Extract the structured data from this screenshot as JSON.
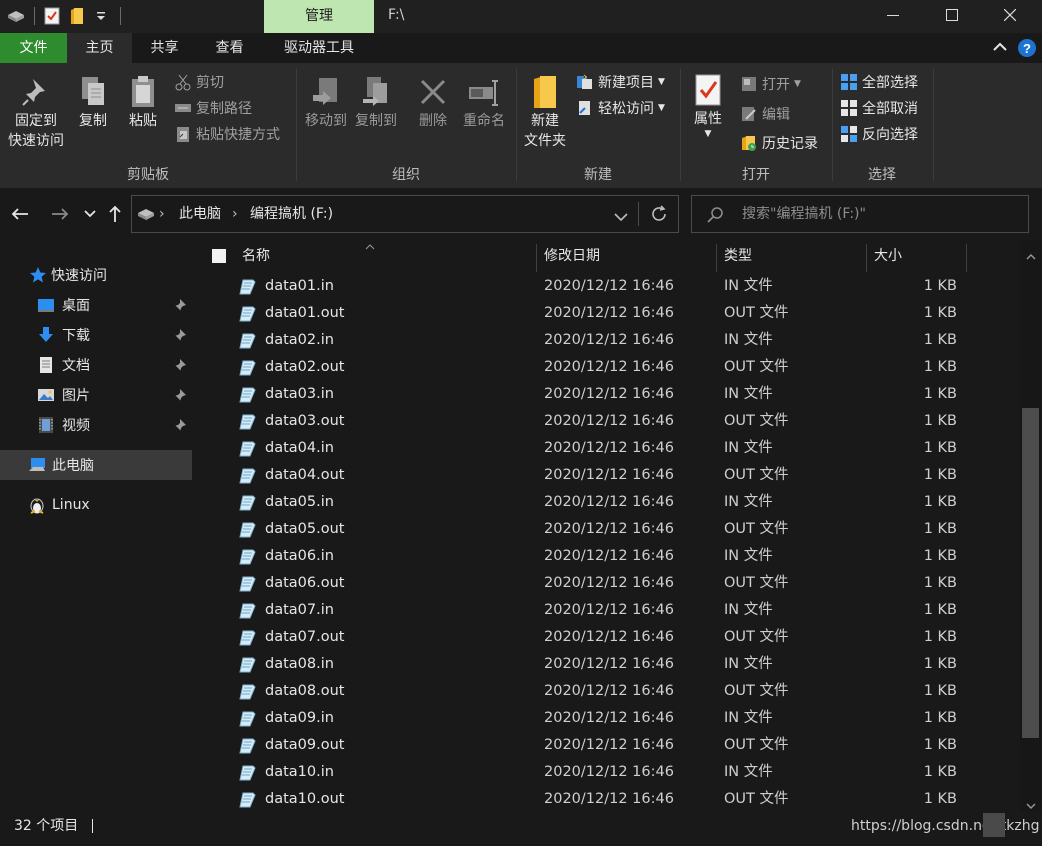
{
  "titlebar": {
    "manage_tab": "管理",
    "title": "F:\\",
    "window_controls": [
      "minimize",
      "maximize",
      "close"
    ]
  },
  "ribbon_tabs": [
    {
      "label": "文件"
    },
    {
      "label": "主页"
    },
    {
      "label": "共享"
    },
    {
      "label": "查看"
    },
    {
      "label": "驱动器工具"
    }
  ],
  "ribbon": {
    "clipboard": {
      "label": "剪贴板",
      "pin_line1": "固定到",
      "pin_line2": "快速访问",
      "copy": "复制",
      "paste": "粘贴",
      "cut": "剪切",
      "copy_path": "复制路径",
      "paste_shortcut": "粘贴快捷方式"
    },
    "organize": {
      "label": "组织",
      "move_to": "移动到",
      "copy_to": "复制到",
      "delete": "删除",
      "rename": "重命名"
    },
    "new": {
      "label": "新建",
      "new_folder_line1": "新建",
      "new_folder_line2": "文件夹",
      "new_item": "新建项目",
      "easy_access": "轻松访问"
    },
    "open": {
      "label": "打开",
      "properties": "属性",
      "open": "打开",
      "edit": "编辑",
      "history": "历史记录"
    },
    "select": {
      "label": "选择",
      "select_all": "全部选择",
      "select_none": "全部取消",
      "invert": "反向选择"
    }
  },
  "address": {
    "crumbs": [
      "此电脑",
      "编程搞机 (F:)"
    ],
    "search_placeholder": "搜索\"编程搞机 (F:)\""
  },
  "nav": {
    "quick_access": "快速访问",
    "desktop": "桌面",
    "downloads": "下载",
    "documents": "文档",
    "pictures": "图片",
    "videos": "视频",
    "this_pc": "此电脑",
    "linux": "Linux"
  },
  "columns": {
    "name": "名称",
    "date": "修改日期",
    "type": "类型",
    "size": "大小"
  },
  "files": [
    {
      "name": "data01.in",
      "date": "2020/12/12 16:46",
      "type": "IN 文件",
      "size": "1 KB"
    },
    {
      "name": "data01.out",
      "date": "2020/12/12 16:46",
      "type": "OUT 文件",
      "size": "1 KB"
    },
    {
      "name": "data02.in",
      "date": "2020/12/12 16:46",
      "type": "IN 文件",
      "size": "1 KB"
    },
    {
      "name": "data02.out",
      "date": "2020/12/12 16:46",
      "type": "OUT 文件",
      "size": "1 KB"
    },
    {
      "name": "data03.in",
      "date": "2020/12/12 16:46",
      "type": "IN 文件",
      "size": "1 KB"
    },
    {
      "name": "data03.out",
      "date": "2020/12/12 16:46",
      "type": "OUT 文件",
      "size": "1 KB"
    },
    {
      "name": "data04.in",
      "date": "2020/12/12 16:46",
      "type": "IN 文件",
      "size": "1 KB"
    },
    {
      "name": "data04.out",
      "date": "2020/12/12 16:46",
      "type": "OUT 文件",
      "size": "1 KB"
    },
    {
      "name": "data05.in",
      "date": "2020/12/12 16:46",
      "type": "IN 文件",
      "size": "1 KB"
    },
    {
      "name": "data05.out",
      "date": "2020/12/12 16:46",
      "type": "OUT 文件",
      "size": "1 KB"
    },
    {
      "name": "data06.in",
      "date": "2020/12/12 16:46",
      "type": "IN 文件",
      "size": "1 KB"
    },
    {
      "name": "data06.out",
      "date": "2020/12/12 16:46",
      "type": "OUT 文件",
      "size": "1 KB"
    },
    {
      "name": "data07.in",
      "date": "2020/12/12 16:46",
      "type": "IN 文件",
      "size": "1 KB"
    },
    {
      "name": "data07.out",
      "date": "2020/12/12 16:46",
      "type": "OUT 文件",
      "size": "1 KB"
    },
    {
      "name": "data08.in",
      "date": "2020/12/12 16:46",
      "type": "IN 文件",
      "size": "1 KB"
    },
    {
      "name": "data08.out",
      "date": "2020/12/12 16:46",
      "type": "OUT 文件",
      "size": "1 KB"
    },
    {
      "name": "data09.in",
      "date": "2020/12/12 16:46",
      "type": "IN 文件",
      "size": "1 KB"
    },
    {
      "name": "data09.out",
      "date": "2020/12/12 16:46",
      "type": "OUT 文件",
      "size": "1 KB"
    },
    {
      "name": "data10.in",
      "date": "2020/12/12 16:46",
      "type": "IN 文件",
      "size": "1 KB"
    },
    {
      "name": "data10.out",
      "date": "2020/12/12 16:46",
      "type": "OUT 文件",
      "size": "1 KB"
    }
  ],
  "status": {
    "item_count": "32 个项目",
    "watermark": "https://blog.csdn.net/tkzhg"
  }
}
